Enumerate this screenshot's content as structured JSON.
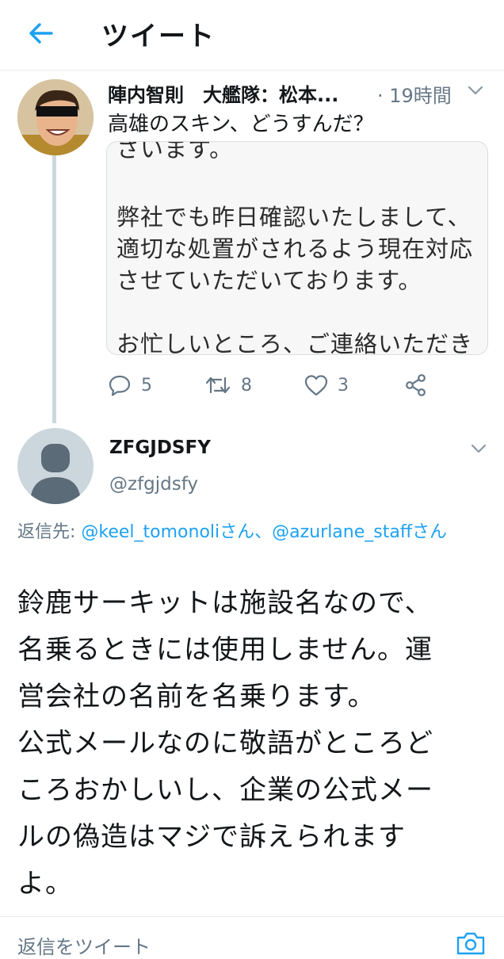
{
  "header": {
    "title": "ツイート",
    "back_icon": "arrow-left-icon",
    "accent": "#1da1f2"
  },
  "parent_tweet": {
    "author": "陣内智則　大艦隊：松本...",
    "time": "· 19時間",
    "text": "高雄のスキン、どうすんだ？",
    "media_lines": [
      "さいます。",
      "弊社でも昨日確認いたしまして、",
      "適切な処置がされるよう現在対応",
      "させていただいております。",
      "お忙しいところ、ご連絡いただき"
    ],
    "replies": "5",
    "retweets": "8",
    "likes": "3"
  },
  "reply_tweet": {
    "name": "ZFGJDSFY",
    "handle": "@zfgjdsfy",
    "replying_label": "返信先: ",
    "mention1": "@keel_tomonoli",
    "san1": "さん、",
    "mention2": "@azurlane_staff",
    "san2": "さん",
    "body": "鈴鹿サーキットは施設名なので、\n名乗るときには使用しません。運\n営会社の名前を名乗ります。\n公式メールなのに敬語がところど\nころおかしいし、企業の公式メー\nルの偽造はマジで訴えられます\nよ。"
  },
  "compose": {
    "placeholder": "返信をツイート",
    "camera_icon": "camera-icon"
  }
}
